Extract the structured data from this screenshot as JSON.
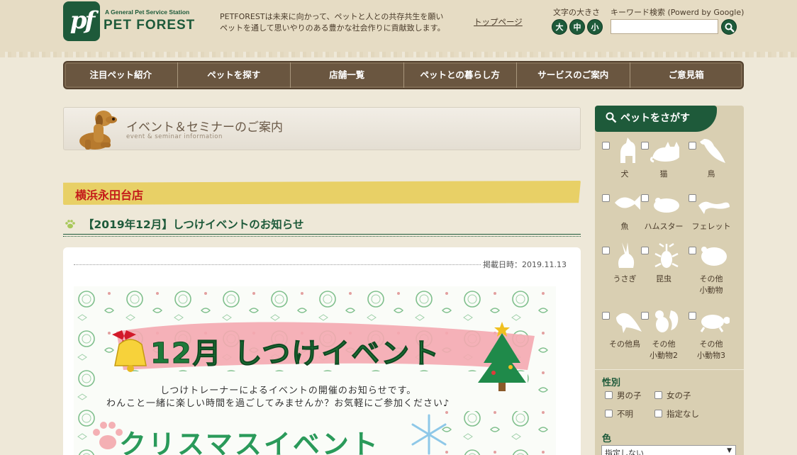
{
  "header": {
    "logo_letters": "pf",
    "logo_tagline": "A General Pet Service Station",
    "logo_name": "PET FOREST",
    "mission_line1": "PETFORESTは未来に向かって、ペットと人との共存共生を願い",
    "mission_line2": "ペットを通して思いやりのある豊かな社会作りに貢献致します。",
    "top_link": "トップページ",
    "font_size_label": "文字の大きさ",
    "font_size_large": "大",
    "font_size_medium": "中",
    "font_size_small": "小",
    "keyword_label": "キーワード検索 (Powerd by Google)",
    "keyword_value": ""
  },
  "nav": {
    "items": [
      {
        "label": "注目ペット紹介"
      },
      {
        "label": "ペットを探す"
      },
      {
        "label": "店舗一覧"
      },
      {
        "label": "ペットとの暮らし方"
      },
      {
        "label": "サービスのご案内"
      },
      {
        "label": "ご意見箱"
      }
    ]
  },
  "main": {
    "section_title": "イベント＆セミナーのご案内",
    "section_subtitle": "event & seminar information",
    "store_name": "横浜永田台店",
    "post_title": "【2019年12月】しつけイベントのお知らせ",
    "posted_date": "掲載日時：2019.11.13",
    "flyer": {
      "headline": "12月 しつけイベント",
      "line1": "しつけトレーナーによるイベントの開催のお知らせです。",
      "line2": "わんこと一緒に楽しい時間を過ごしてみませんか？お気軽にご参加ください♪",
      "sub_headline": "クリスマスイベント"
    }
  },
  "sidebar": {
    "heading": "ペットをさがす",
    "pets": [
      {
        "label": "犬",
        "icon": "dog-icon"
      },
      {
        "label": "猫",
        "icon": "cat-icon"
      },
      {
        "label": "鳥",
        "icon": "bird-icon"
      },
      {
        "label": "魚",
        "icon": "fish-icon"
      },
      {
        "label": "ハムスター",
        "icon": "hamster-icon"
      },
      {
        "label": "フェレット",
        "icon": "ferret-icon"
      },
      {
        "label": "うさぎ",
        "icon": "rabbit-icon"
      },
      {
        "label": "昆虫",
        "icon": "beetle-icon"
      },
      {
        "label": "その他\n小動物",
        "icon": "small-animal-icon"
      },
      {
        "label": "その他鳥",
        "icon": "other-bird-icon"
      },
      {
        "label": "その他\n小動物2",
        "icon": "squirrel-icon"
      },
      {
        "label": "その他\n小動物3",
        "icon": "turtle-icon"
      }
    ],
    "gender_label": "性別",
    "gender_options": [
      "男の子",
      "女の子",
      "不明",
      "指定なし"
    ],
    "color_label": "色",
    "color_selected": "指定しない"
  },
  "colors": {
    "brand_green": "#1e5a3a",
    "nav_brown": "#6a5640",
    "store_name_red": "#c41a1a",
    "sidebar_tan": "#d9cfb2"
  }
}
